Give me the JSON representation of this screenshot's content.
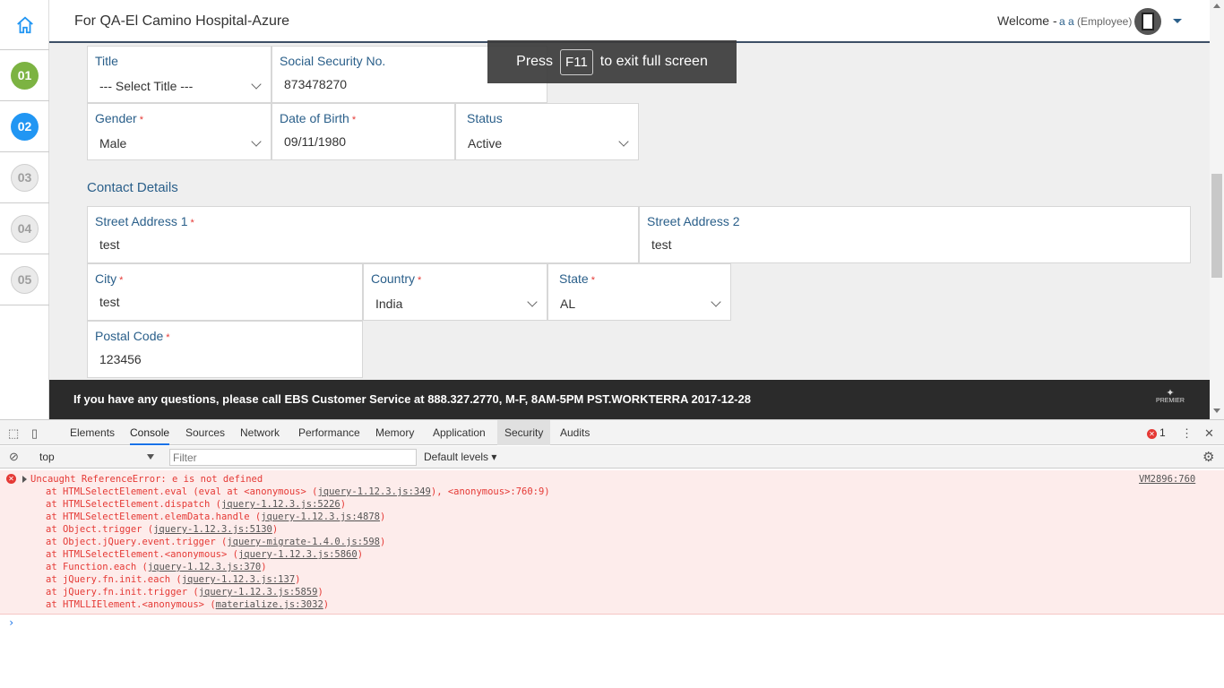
{
  "header": {
    "title": "For QA-El Camino Hospital-Azure",
    "welcome": "Welcome -",
    "user_name": "a a",
    "user_role": "(Employee)"
  },
  "steps": [
    "01",
    "02",
    "03",
    "04",
    "05"
  ],
  "form": {
    "title": {
      "label": "Title",
      "value": "--- Select Title ---"
    },
    "ssn": {
      "label": "Social Security No.",
      "value": "873478270"
    },
    "gender": {
      "label": "Gender",
      "value": "Male"
    },
    "dob": {
      "label": "Date of Birth",
      "value": "09/11/1980"
    },
    "status": {
      "label": "Status",
      "value": "Active"
    },
    "contact_title": "Contact Details",
    "street1": {
      "label": "Street Address 1",
      "value": "test"
    },
    "street2": {
      "label": "Street Address 2",
      "value": "test"
    },
    "city": {
      "label": "City",
      "value": "test"
    },
    "country": {
      "label": "Country",
      "value": "India"
    },
    "state": {
      "label": "State",
      "value": "AL"
    },
    "postal": {
      "label": "Postal Code",
      "value": "123456"
    },
    "required_mark": "*"
  },
  "toast": {
    "press": "Press",
    "key": "F11",
    "rest": "to exit full screen"
  },
  "footer": {
    "text": "If you have any questions, please call EBS Customer Service at 888.327.2770, M-F, 8AM-5PM PST.WORKTERRA 2017-12-28",
    "logo_text": "PREMIER"
  },
  "devtools": {
    "tabs": [
      "Elements",
      "Console",
      "Sources",
      "Network",
      "Performance",
      "Memory",
      "Application",
      "Security",
      "Audits"
    ],
    "error_count": "1",
    "context": "top",
    "filter_placeholder": "Filter",
    "levels": "Default levels",
    "error": {
      "message": "Uncaught ReferenceError: e is not defined",
      "source": "VM2896:760",
      "stack": [
        {
          "text": "at HTMLSelectElement.eval (eval at <anonymous> (",
          "link": "jquery-1.12.3.js:349",
          "tail": "), <anonymous>:760:9)"
        },
        {
          "text": "at HTMLSelectElement.dispatch (",
          "link": "jquery-1.12.3.js:5226",
          "tail": ")"
        },
        {
          "text": "at HTMLSelectElement.elemData.handle (",
          "link": "jquery-1.12.3.js:4878",
          "tail": ")"
        },
        {
          "text": "at Object.trigger (",
          "link": "jquery-1.12.3.js:5130",
          "tail": ")"
        },
        {
          "text": "at Object.jQuery.event.trigger (",
          "link": "jquery-migrate-1.4.0.js:598",
          "tail": ")"
        },
        {
          "text": "at HTMLSelectElement.<anonymous> (",
          "link": "jquery-1.12.3.js:5860",
          "tail": ")"
        },
        {
          "text": "at Function.each (",
          "link": "jquery-1.12.3.js:370",
          "tail": ")"
        },
        {
          "text": "at jQuery.fn.init.each (",
          "link": "jquery-1.12.3.js:137",
          "tail": ")"
        },
        {
          "text": "at jQuery.fn.init.trigger (",
          "link": "jquery-1.12.3.js:5859",
          "tail": ")"
        },
        {
          "text": "at HTMLLIElement.<anonymous> (",
          "link": "materialize.js:3032",
          "tail": ")"
        }
      ]
    },
    "prompt": "›"
  },
  "colors": {
    "accent": "#2a5f8a",
    "step_done": "#7cb342",
    "step_active": "#2196f3",
    "error": "#e53935"
  }
}
